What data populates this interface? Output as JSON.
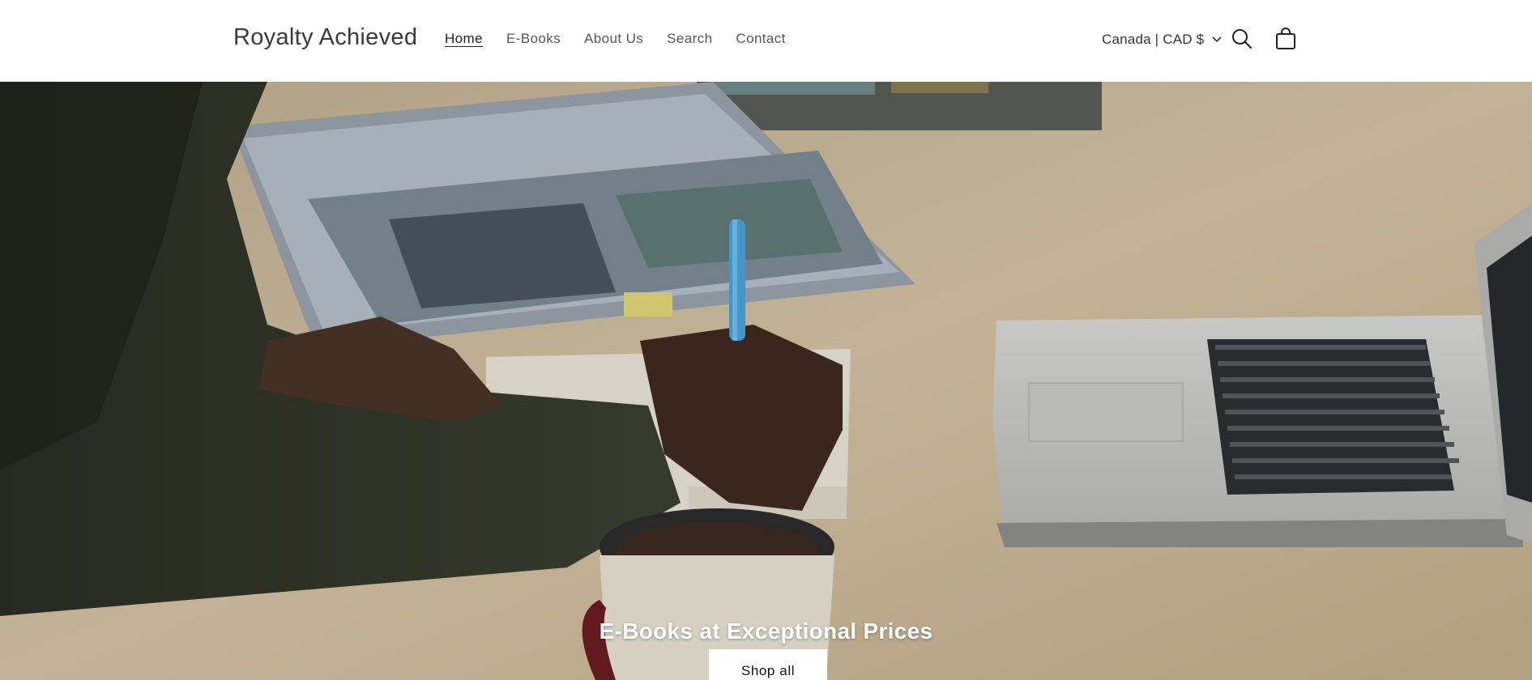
{
  "header": {
    "logo": "Royalty Achieved",
    "nav": [
      {
        "label": "Home",
        "active": true
      },
      {
        "label": "E-Books",
        "active": false
      },
      {
        "label": "About Us",
        "active": false
      },
      {
        "label": "Search",
        "active": false
      },
      {
        "label": "Contact",
        "active": false
      }
    ],
    "locale": "Canada | CAD $",
    "icons": {
      "locale_chevron": "chevron-down-icon",
      "search": "search-icon",
      "cart": "cart-icon"
    }
  },
  "hero": {
    "heading": "E-Books at Exceptional Prices",
    "button_label": "Shop all",
    "image": "photo of a person writing in a notebook at a wooden desk beside an open book, a mug and a laptop"
  },
  "colors": {
    "header_bg": "#ffffff",
    "button_bg": "#ffffff",
    "text": "#121212",
    "desk": "#cdb99a"
  }
}
